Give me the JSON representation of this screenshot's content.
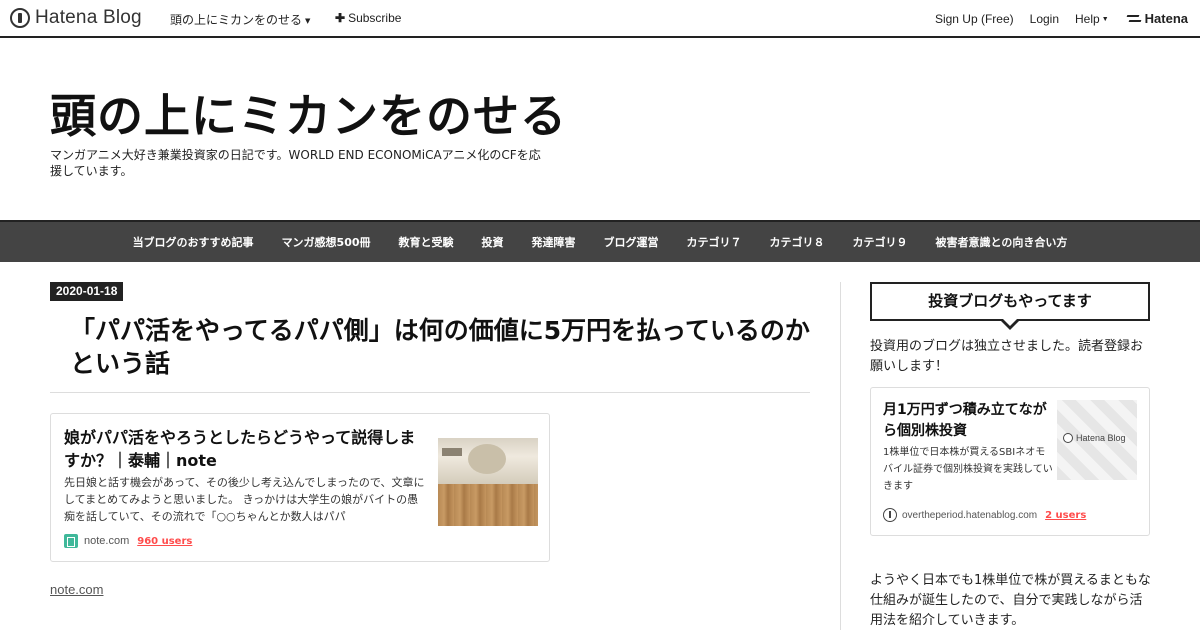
{
  "globalbar": {
    "logo_text": "Hatena Blog",
    "blog_menu": "頭の上にミカンをのせる",
    "subscribe": "Subscribe",
    "sign_up": "Sign Up (Free)",
    "login": "Login",
    "help": "Help",
    "hatena": "Hatena"
  },
  "blog": {
    "title": "頭の上にミカンをのせる",
    "description": "マンガアニメ大好き兼業投資家の日記です。WORLD END ECONOMiCAアニメ化のCFを応援しています。"
  },
  "categories": [
    "当ブログのおすすめ記事",
    "マンガ感想500冊",
    "教育と受験",
    "投資",
    "発達障害",
    "ブログ運営",
    "カテゴリ７",
    "カテゴリ８",
    "カテゴリ９",
    "被害者意識との向き合い方"
  ],
  "entry": {
    "date": "2020-01-18",
    "title": "「パパ活をやってるパパ側」は何の価値に5万円を払っているのかという話",
    "embed": {
      "title": "娘がパパ活をやろうとしたらどうやって説得しますか？｜泰輔｜note",
      "description": "先日娘と話す機会があって、その後少し考え込んでしまったので、文章にしてまとめてみようと思いました。 きっかけは大学生の娘がバイトの愚痴を話していて、その流れで「○○ちゃんとか数人はパパ",
      "domain": "note.com",
      "users": "960 users"
    },
    "source_link": "note.com"
  },
  "sidebar": {
    "heading": "投資ブログもやってます",
    "intro": "投資用のブログは独立させました。読者登録お願いします！",
    "card": {
      "title": "月1万円ずつ積み立てながら個別株投資",
      "description": "1株単位で日本株が買えるSBIネオモバイル証券で個別株投資を実践していきます",
      "thumb_label": "Hatena Blog",
      "domain": "overtheperiod.hatenablog.com",
      "users": "2 users"
    },
    "text2": "ようやく日本でも1株単位で株が買えるまともな仕組みが誕生したので、自分で実践しながら活用法を紹介していきます。"
  },
  "colors": {
    "nav_bg": "#444444",
    "accent_users": "#ff4b4b",
    "date_bg": "#222222"
  }
}
